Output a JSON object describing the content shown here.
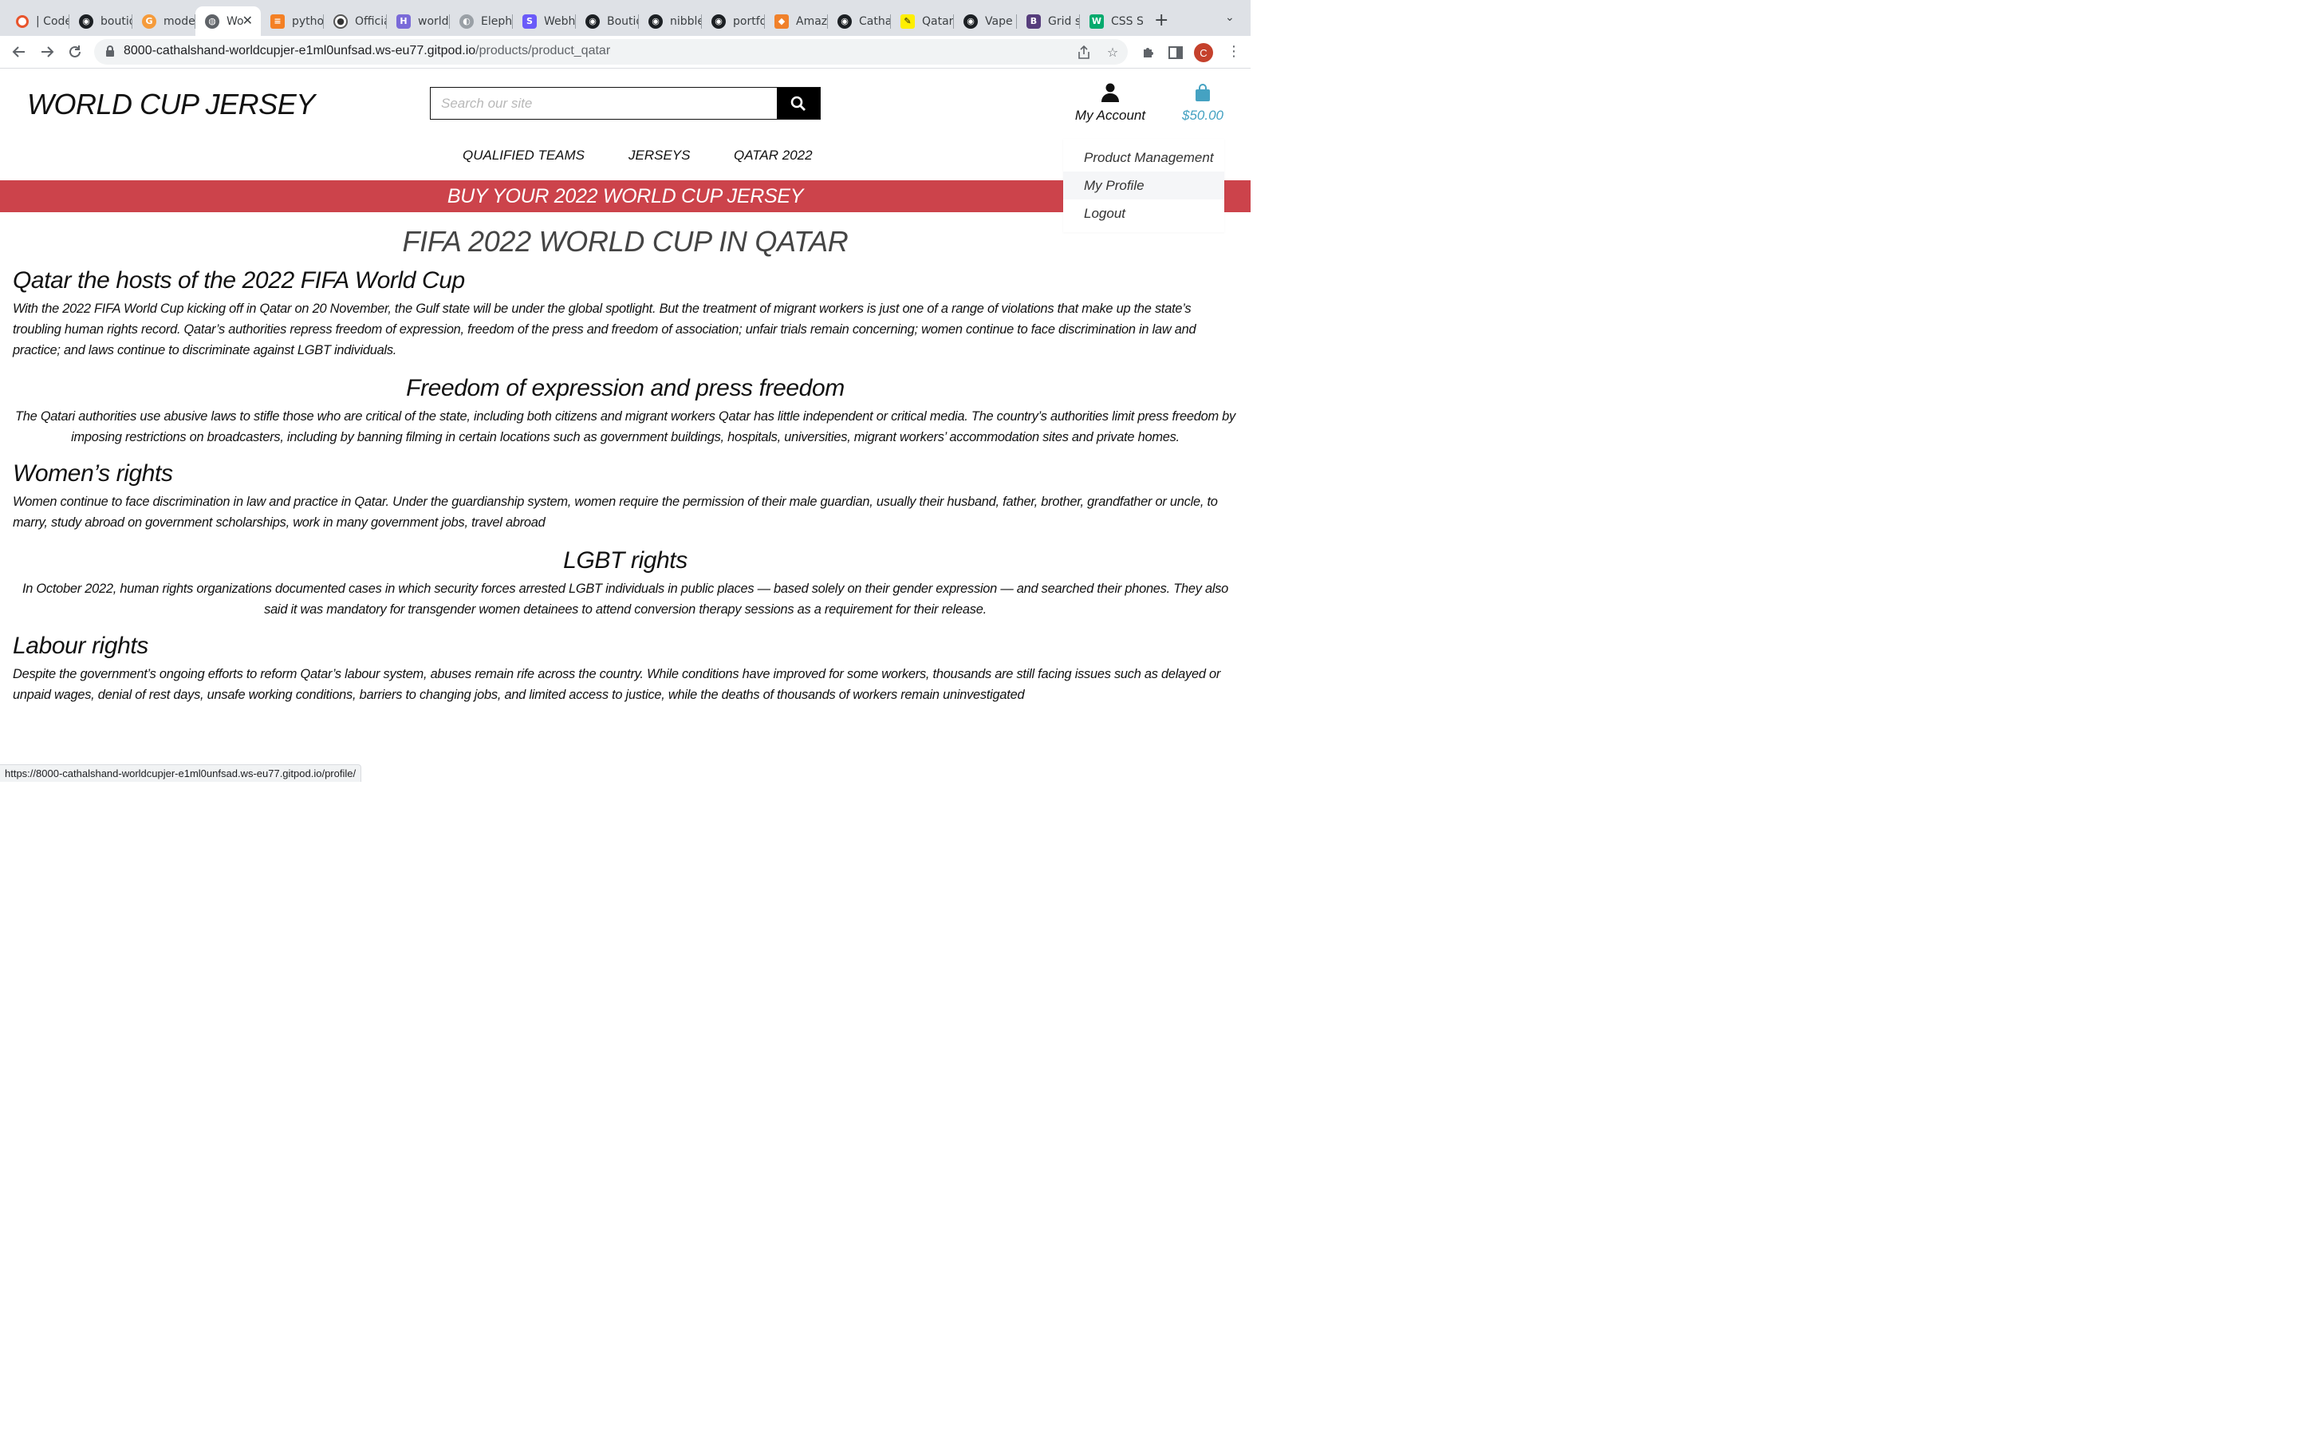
{
  "browser": {
    "tabs": [
      {
        "label": "| Code",
        "icon": "ring-icon"
      },
      {
        "label": "boutique",
        "icon": "github-icon"
      },
      {
        "label": "model",
        "icon": "g-icon"
      },
      {
        "label": "Wo",
        "icon": "globe-icon"
      },
      {
        "label": "python",
        "icon": "stack-overflow-icon"
      },
      {
        "label": "Official",
        "icon": "football-icon"
      },
      {
        "label": "world",
        "icon": "h-icon"
      },
      {
        "label": "Elephant",
        "icon": "elephant-icon"
      },
      {
        "label": "Webhook",
        "icon": "s-icon"
      },
      {
        "label": "Boutique",
        "icon": "github-icon"
      },
      {
        "label": "nibble",
        "icon": "github-icon"
      },
      {
        "label": "portfolio",
        "icon": "github-icon"
      },
      {
        "label": "Amazon",
        "icon": "box-icon"
      },
      {
        "label": "Cathal",
        "icon": "github-icon"
      },
      {
        "label": "Qatar",
        "icon": "amnesty-icon"
      },
      {
        "label": "Vape",
        "icon": "github-icon"
      },
      {
        "label": "Grid s",
        "icon": "bootstrap-icon"
      },
      {
        "label": "CSS S",
        "icon": "w3-icon"
      }
    ],
    "url_host": "8000-cathalshand-worldcupjer-e1ml0unfsad.ws-eu77.gitpod.io",
    "url_path": "/products/product_qatar",
    "profile_initial": "C",
    "status_url": "https://8000-cathalshand-worldcupjer-e1ml0unfsad.ws-eu77.gitpod.io/profile/"
  },
  "header": {
    "brand": "WORLD CUP JERSEY",
    "search_placeholder": "Search our site",
    "account_label": "My Account",
    "bag_total": "$50.00"
  },
  "nav": {
    "items": [
      "QUALIFIED TEAMS",
      "JERSEYS",
      "QATAR 2022"
    ]
  },
  "account_menu": {
    "items": [
      "Product Management",
      "My Profile",
      "Logout"
    ]
  },
  "banner": {
    "text": "BUY YOUR 2022 WORLD CUP JERSEY"
  },
  "main": {
    "title": "FIFA 2022 WORLD CUP IN QATAR",
    "sections": [
      {
        "heading": "Qatar the hosts of the 2022 FIFA World Cup",
        "body": "With the 2022 FIFA World Cup kicking off in Qatar on 20 November, the Gulf state will be under the global spotlight. But the treatment of migrant workers is just one of a range of violations that make up the state’s troubling human rights record. Qatar’s authorities repress freedom of expression, freedom of the press and freedom of association; unfair trials remain concerning; women continue to face discrimination in law and practice; and laws continue to discriminate against LGBT individuals."
      },
      {
        "heading": "Freedom of expression and press freedom",
        "body": "The Qatari authorities use abusive laws to stifle those who are critical of the state, including both citizens and migrant workers Qatar has little independent or critical media. The country’s authorities limit press freedom by imposing restrictions on broadcasters, including by banning filming in certain locations such as government buildings, hospitals, universities, migrant workers’ accommodation sites and private homes."
      },
      {
        "heading": "Women’s rights",
        "body": "Women continue to face discrimination in law and practice in Qatar. Under the guardianship system, women require the permission of their male guardian, usually their husband, father, brother, grandfather or uncle, to marry, study abroad on government scholarships, work in many government jobs, travel abroad"
      },
      {
        "heading": "LGBT rights",
        "body": "In October 2022, human rights organizations documented cases in which security forces arrested LGBT individuals in public places — based solely on their gender expression — and searched their phones. They also said it was mandatory for transgender women detainees to attend conversion therapy sessions as a requirement for their release."
      },
      {
        "heading": "Labour rights",
        "body": "Despite the government’s ongoing efforts to reform Qatar’s labour system, abuses remain rife across the country. While conditions have improved for some workers, thousands are still facing issues such as delayed or unpaid wages, denial of rest days, unsafe working conditions, barriers to changing jobs, and limited access to justice, while the deaths of thousands of workers remain uninvestigated"
      }
    ]
  },
  "colors": {
    "banner": "#cc434b",
    "bag_accent": "#45a2c2",
    "search_button": "#000000"
  }
}
